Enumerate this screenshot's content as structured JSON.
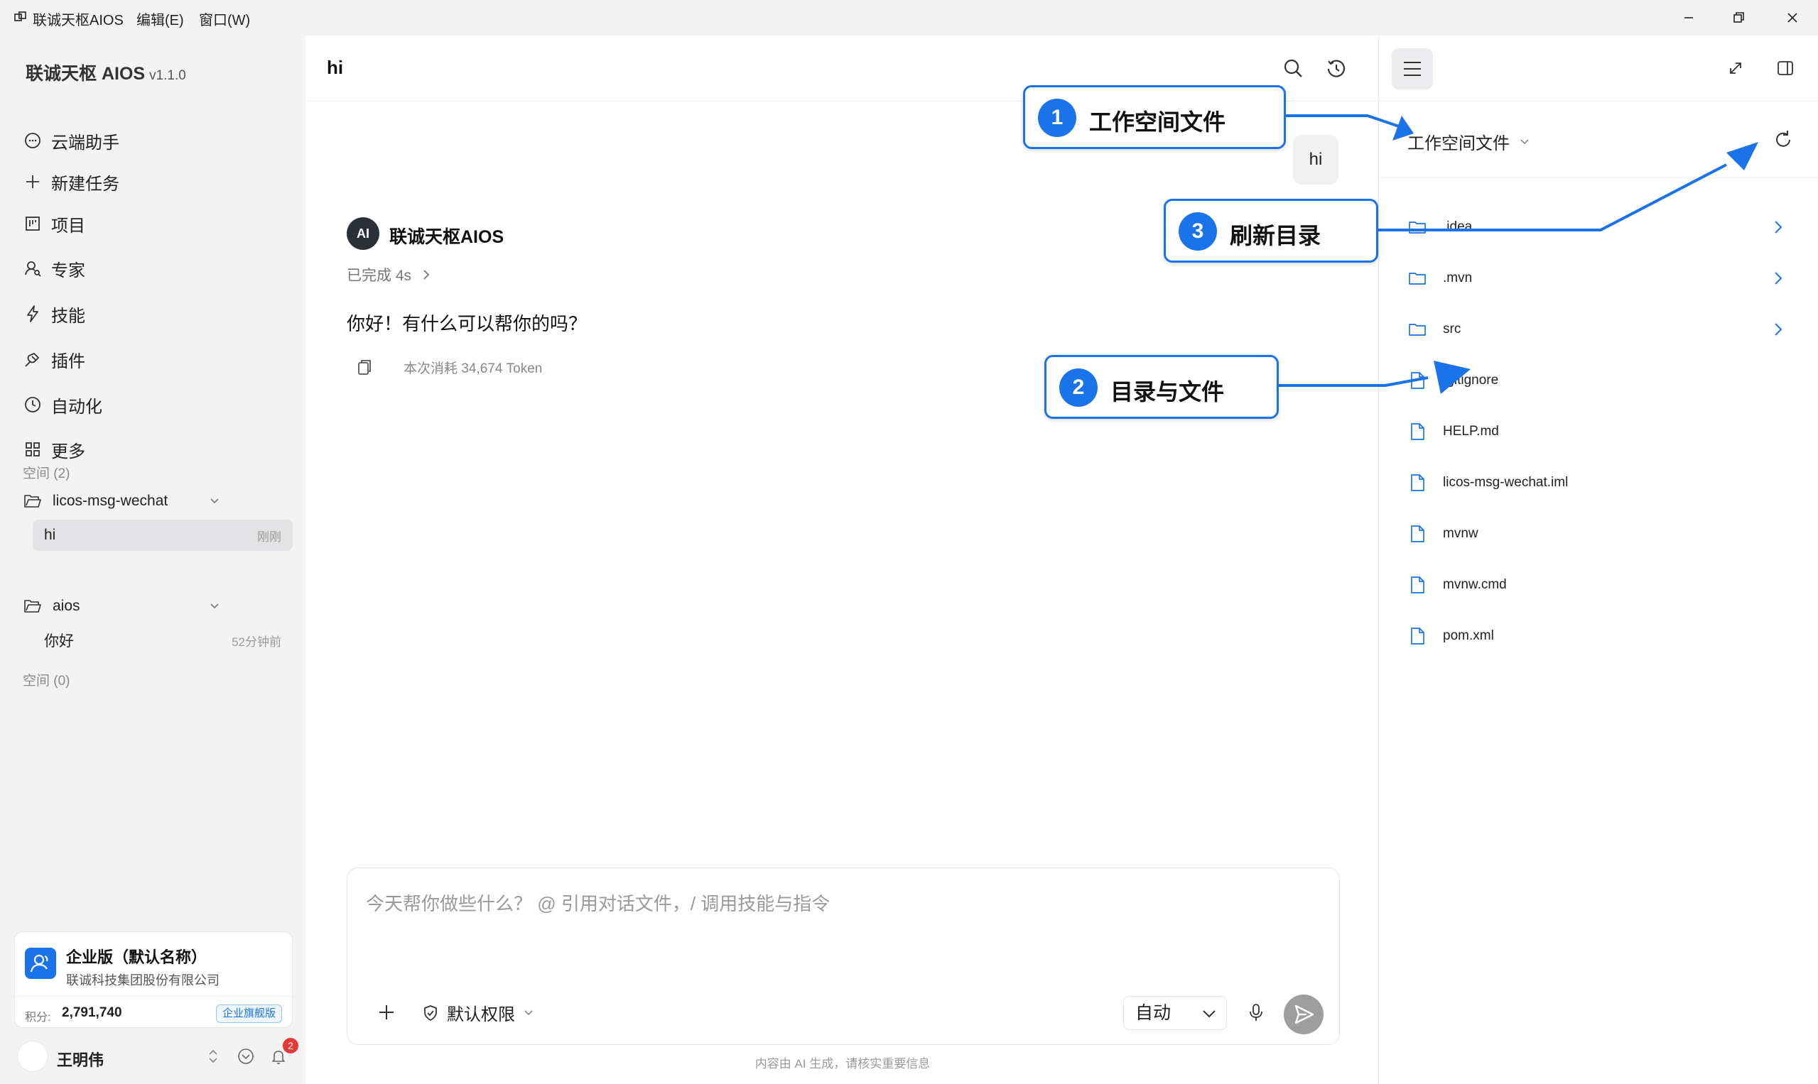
{
  "titlebar": {
    "app_name": "联诚天枢AIOS",
    "menus": [
      "编辑(E)",
      "窗口(W)"
    ]
  },
  "sidebar": {
    "brand": "联诚天枢 AIOS",
    "version": "v1.1.0",
    "nav": [
      {
        "label": "云端助手",
        "icon": "chat-bubble-icon"
      },
      {
        "label": "新建任务",
        "icon": "plus-icon"
      },
      {
        "label": "项目",
        "icon": "kanban-icon"
      },
      {
        "label": "专家",
        "icon": "expert-icon"
      },
      {
        "label": "技能",
        "icon": "lightning-icon"
      },
      {
        "label": "插件",
        "icon": "plug-icon"
      },
      {
        "label": "自动化",
        "icon": "clock-icon"
      },
      {
        "label": "更多",
        "icon": "grid-icon"
      }
    ],
    "spaces_label": "空间 (2)",
    "spaces": [
      {
        "name": "licos-msg-wechat",
        "conversations": [
          {
            "title": "hi",
            "time": "刚刚"
          }
        ]
      },
      {
        "name": "aios",
        "conversations": [
          {
            "title": "你好",
            "time": "52分钟前"
          }
        ]
      }
    ],
    "spaces_label_2": "空间 (0)",
    "enterprise": {
      "name": "企业版（默认名称）",
      "company": "联诚科技集团股份有限公司",
      "points_label": "积分:",
      "points": "2,791,740",
      "badge": "企业旗舰版"
    },
    "user": {
      "name": "王明伟",
      "notifications": "2"
    }
  },
  "chat": {
    "title": "hi",
    "user_message": "hi",
    "ai_avatar": "AI",
    "ai_name": "联诚天枢AIOS",
    "ai_status": "已完成 4s",
    "ai_reply": "你好！有什么可以帮你的吗？",
    "token_usage": "本次消耗 34,674 Token",
    "composer": {
      "placeholder": "今天帮你做些什么？ @ 引用对话文件，/ 调用技能与指令",
      "permission": "默认权限",
      "mode": "自动"
    },
    "disclaimer": "内容由 AI 生成，请核实重要信息"
  },
  "workspace": {
    "title": "工作空间文件",
    "files": [
      {
        "name": ".idea",
        "type": "folder"
      },
      {
        "name": ".mvn",
        "type": "folder"
      },
      {
        "name": "src",
        "type": "folder"
      },
      {
        "name": ".gitignore",
        "type": "file"
      },
      {
        "name": "HELP.md",
        "type": "file"
      },
      {
        "name": "licos-msg-wechat.iml",
        "type": "file"
      },
      {
        "name": "mvnw",
        "type": "file"
      },
      {
        "name": "mvnw.cmd",
        "type": "file"
      },
      {
        "name": "pom.xml",
        "type": "file"
      }
    ]
  },
  "annotations": [
    {
      "num": "1",
      "label": "工作空间文件"
    },
    {
      "num": "2",
      "label": "目录与文件"
    },
    {
      "num": "3",
      "label": "刷新目录"
    }
  ],
  "colors": {
    "accent": "#1a73e8",
    "sidebar_bg": "#f3f3f4",
    "notification": "#e53935"
  }
}
